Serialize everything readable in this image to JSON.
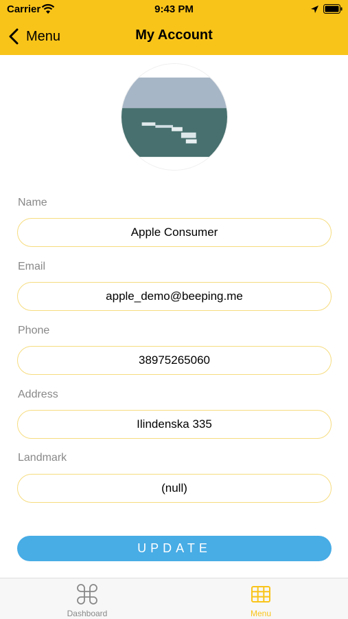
{
  "status_bar": {
    "carrier": "Carrier",
    "time": "9:43 PM"
  },
  "nav": {
    "back_label": "Menu",
    "title": "My Account"
  },
  "form": {
    "name": {
      "label": "Name",
      "value": "Apple Consumer"
    },
    "email": {
      "label": "Email",
      "value": "apple_demo@beeping.me"
    },
    "phone": {
      "label": "Phone",
      "value": "38975265060"
    },
    "address": {
      "label": "Address",
      "value": "Ilindenska 335"
    },
    "landmark": {
      "label": "Landmark",
      "value": "(null)"
    }
  },
  "update_button": {
    "label": "UPDATE"
  },
  "tabbar": {
    "items": [
      {
        "label": "Dashboard",
        "icon": "command-icon",
        "active": false
      },
      {
        "label": "Menu",
        "icon": "grid-icon",
        "active": true
      }
    ]
  },
  "colors": {
    "header": "#f9c41a",
    "accent": "#f9c41a",
    "button": "#48ace5",
    "field_border": "#f6dc7e",
    "label": "#888888"
  }
}
